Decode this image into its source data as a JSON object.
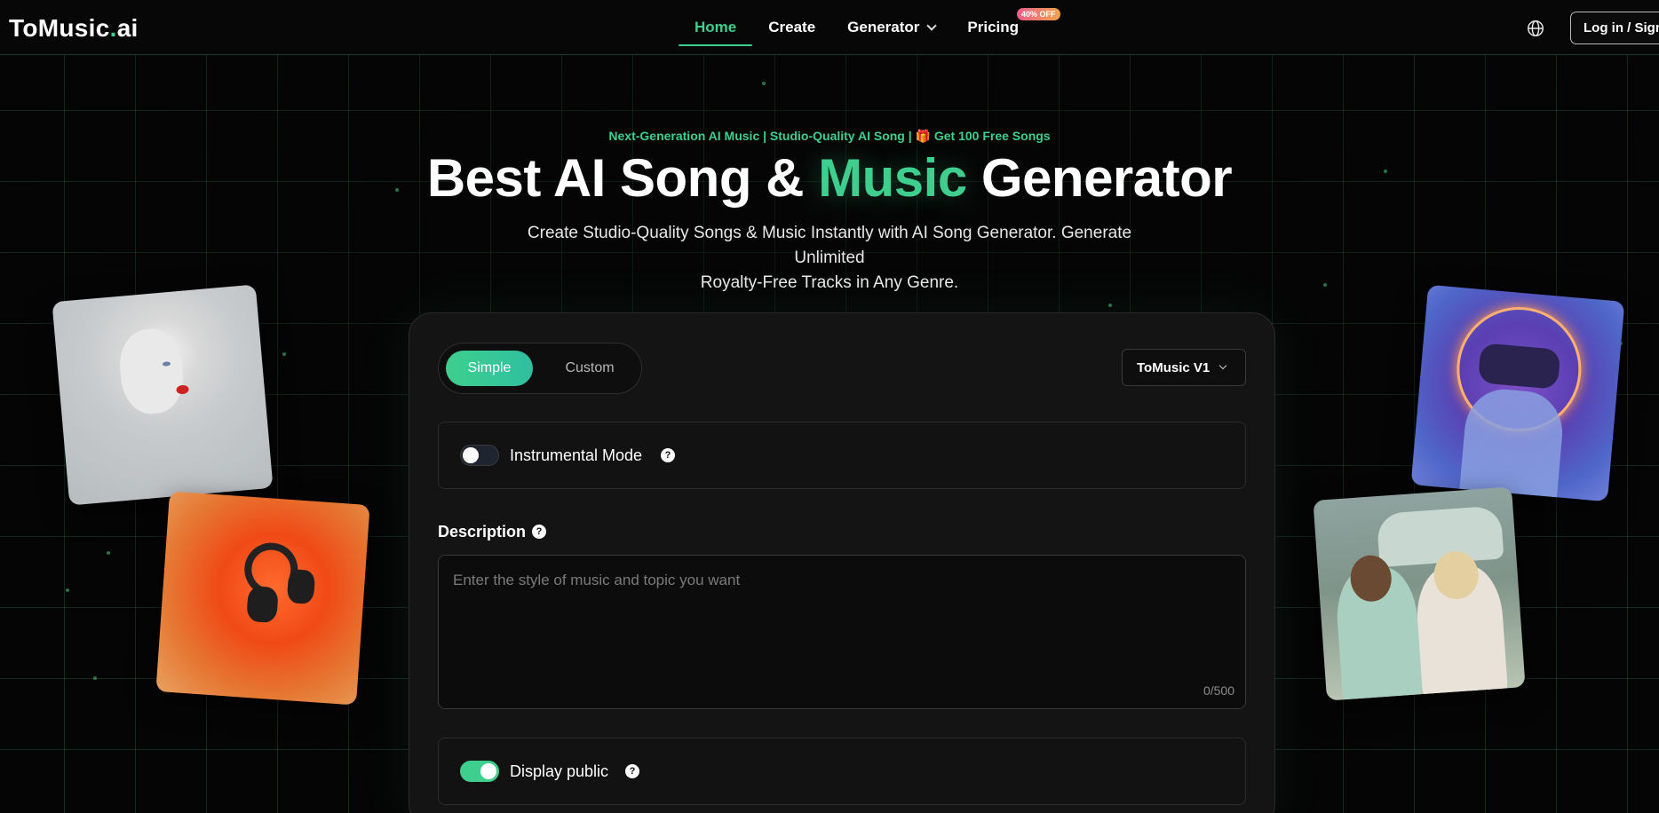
{
  "header": {
    "logo": {
      "main": "ToMusic",
      "dot": ".",
      "suffix": "ai"
    },
    "nav": [
      {
        "label": "Home"
      },
      {
        "label": "Create"
      },
      {
        "label": "Generator"
      },
      {
        "label": "Pricing"
      }
    ],
    "pricing_badge": "40% OFF",
    "login_label": "Log in / Sign Up"
  },
  "hero": {
    "tagline": "Next-Generation AI Music | Studio-Quality AI Song | 🎁 Get 100 Free Songs",
    "title_part1": "Best AI Song & ",
    "title_highlight": "Music",
    "title_part2": " Generator",
    "subtitle_line1": "Create Studio-Quality Songs & Music Instantly with AI Song Generator. Generate Unlimited",
    "subtitle_line2": "Royalty-Free Tracks in Any Genre."
  },
  "form": {
    "modes": {
      "simple": "Simple",
      "custom": "Custom",
      "selected": "Simple"
    },
    "model": "ToMusic V1",
    "instrumental": {
      "label": "Instrumental Mode",
      "enabled": false
    },
    "description": {
      "label": "Description",
      "placeholder": "Enter the style of music and topic you want",
      "value": "",
      "counter": "0/500"
    },
    "display_public": {
      "label": "Display public",
      "enabled": true
    }
  },
  "colors": {
    "accent": "#3ecf8e",
    "background": "#050505",
    "card": "#141414"
  },
  "icons": {
    "globe": "globe-icon",
    "help": "question-circle-icon",
    "dropdown": "chevron-down-icon"
  }
}
